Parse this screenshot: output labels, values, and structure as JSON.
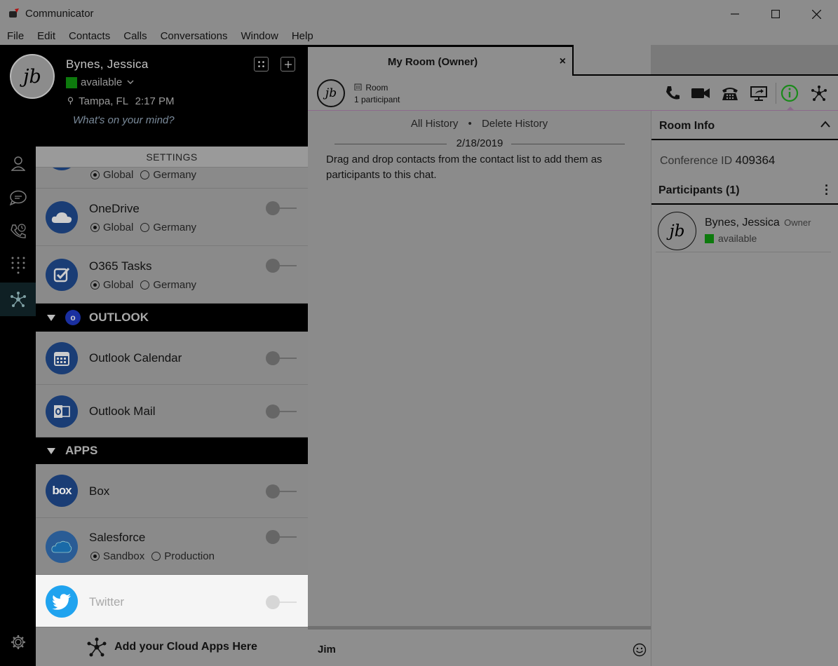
{
  "window": {
    "title": "Communicator"
  },
  "menu": [
    "File",
    "Edit",
    "Contacts",
    "Calls",
    "Conversations",
    "Window",
    "Help"
  ],
  "profile": {
    "initials": "jb",
    "name": "Bynes, Jessica",
    "status": "available",
    "location": "Tampa, FL",
    "time": "2:17 PM",
    "mind_placeholder": "What's on your mind?"
  },
  "settings": {
    "header": "SETTINGS",
    "partial_row": {
      "options": [
        "Global",
        "Germany"
      ]
    },
    "rows": [
      {
        "name": "OneDrive",
        "options": [
          "Global",
          "Germany"
        ],
        "selected": "Global"
      },
      {
        "name": "O365 Tasks",
        "options": [
          "Global",
          "Germany"
        ],
        "selected": "Global"
      }
    ],
    "outlook_section": {
      "title": "OUTLOOK",
      "icon_letter": "o"
    },
    "outlook_rows": [
      {
        "name": "Outlook Calendar"
      },
      {
        "name": "Outlook Mail"
      }
    ],
    "apps_section": {
      "title": "APPS"
    },
    "app_rows": [
      {
        "name": "Box",
        "icon_text": "box"
      },
      {
        "name": "Salesforce",
        "options": [
          "Sandbox",
          "Production"
        ],
        "selected": "Sandbox"
      },
      {
        "name": "Twitter"
      }
    ],
    "add_cloud": "Add your Cloud Apps Here"
  },
  "chat": {
    "tab_title": "My Room (Owner)",
    "tab_close": "×",
    "room_initials": "jb",
    "room_type": "Room",
    "participant_count": "1 participant",
    "history_all": "All History",
    "history_sep": "•",
    "history_delete": "Delete History",
    "date": "2/18/2019",
    "system_message": "Drag and drop contacts from the contact list to add them as participants to this chat.",
    "input_value": "Jim"
  },
  "room_info": {
    "title": "Room Info",
    "conference_label": "Conference ID",
    "conference_id": "409364",
    "participants_title": "Participants (1)",
    "participants": [
      {
        "initials": "jb",
        "name": "Bynes, Jessica",
        "role": "Owner",
        "status": "available"
      }
    ]
  },
  "colors": {
    "status_green": "#0d7a0d",
    "twitter_blue": "#20a3ef",
    "app_navy": "#1a3d75",
    "info_green": "#1a8a1a"
  }
}
